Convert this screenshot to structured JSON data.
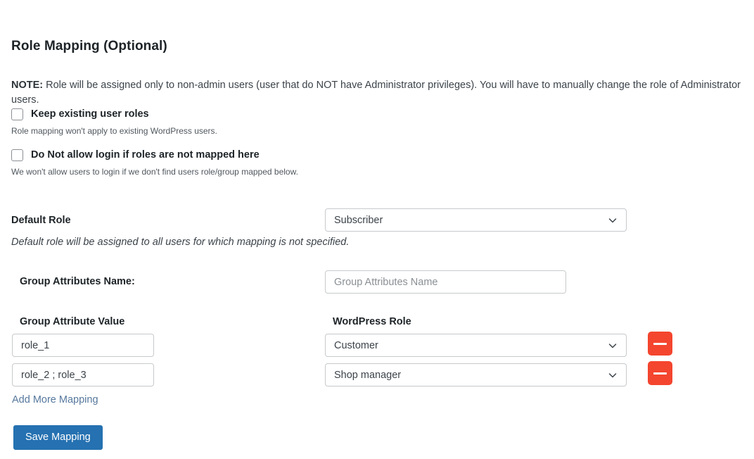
{
  "section": {
    "title": "Role Mapping (Optional)",
    "note_prefix": "NOTE:",
    "note_text": " Role will be assigned only to non-admin users (user that do NOT have Administrator privileges). You will have to manually change the role of Administrator users."
  },
  "options": [
    {
      "label": "Keep existing user roles",
      "checked": false,
      "description": "Role mapping won't apply to existing WordPress users."
    },
    {
      "label": "Do Not allow login if roles are not mapped here",
      "checked": false,
      "description": "We won't allow users to login if we don't find users role/group mapped below."
    }
  ],
  "default_role": {
    "label": "Default Role",
    "value": "Subscriber",
    "description": "Default role will be assigned to all users for which mapping is not specified.",
    "chevron_icon": "chevron-down-icon"
  },
  "group_attributes": {
    "label": "Group Attributes Name:",
    "value": "",
    "placeholder": "Group Attributes Name"
  },
  "mapping_table": {
    "headers": {
      "value": "Group Attribute Value",
      "role": "WordPress Role"
    },
    "rows": [
      {
        "value": "role_1",
        "role": "Customer",
        "delete_icon": "minus-icon"
      },
      {
        "value": "role_2 ; role_3",
        "role": "Shop manager",
        "delete_icon": "minus-icon"
      }
    ]
  },
  "footer": {
    "add_more_label": "Add More Mapping",
    "save_label": "Save Mapping"
  },
  "colors": {
    "primary": "#2571b1",
    "danger": "#f4452e",
    "link": "#56789d",
    "border": "#c7c9cc"
  }
}
